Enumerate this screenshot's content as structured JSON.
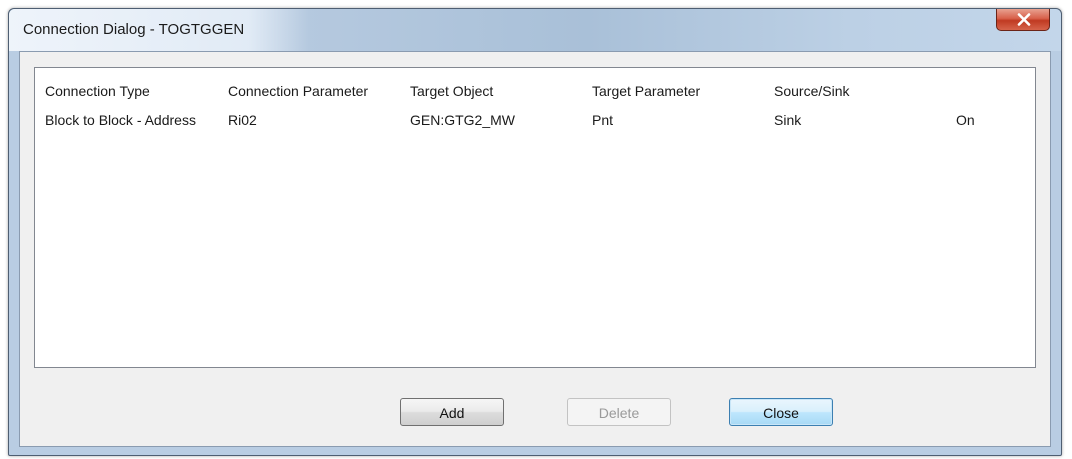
{
  "window": {
    "title": "Connection Dialog - TOGTGGEN"
  },
  "titlebar_buttons": {
    "close_icon": "close-x-icon"
  },
  "listview": {
    "columns": [
      "Connection Type",
      "Connection Parameter",
      "Target Object",
      "Target Parameter",
      "Source/Sink",
      ""
    ],
    "rows": [
      [
        "Block to Block - Address",
        "Ri02",
        "GEN:GTG2_MW",
        "Pnt",
        "Sink",
        "On"
      ]
    ]
  },
  "buttons": {
    "add_label": "Add",
    "delete_label": "Delete",
    "close_label": "Close",
    "delete_enabled": false
  },
  "colors": {
    "title_close_button": "#c8472e",
    "focused_button_border": "#3c7fb1",
    "disabled_text": "#9a9a9a"
  }
}
